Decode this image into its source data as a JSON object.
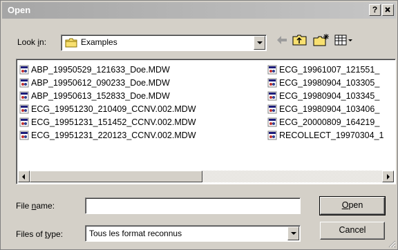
{
  "window": {
    "title": "Open",
    "help_label": "?",
    "close_label": "X"
  },
  "lookin": {
    "label_pre": "Look ",
    "label_u": "i",
    "label_post": "n:",
    "value": "Examples"
  },
  "files": {
    "col1": [
      "ABP_19950529_121633_Doe.MDW",
      "ABP_19950612_090233_Doe.MDW",
      "ABP_19950613_152833_Doe.MDW",
      "ECG_19951230_210409_CCNV.002.MDW",
      "ECG_19951231_151452_CCNV.002.MDW",
      "ECG_19951231_220123_CCNV.002.MDW"
    ],
    "col2": [
      "ECG_19961007_121551_",
      "ECG_19980904_103305_",
      "ECG_19980904_103345_",
      "ECG_19980904_103406_",
      "ECG_20000809_164219_",
      "RECOLLECT_19970304_1"
    ]
  },
  "filename": {
    "label_pre": "File ",
    "label_u": "n",
    "label_post": "ame:",
    "value": ""
  },
  "filetype": {
    "label_pre": "Files of ",
    "label_u": "t",
    "label_post": "ype:",
    "value": "Tous les format reconnus"
  },
  "buttons": {
    "open_u": "O",
    "open_rest": "pen",
    "cancel": "Cancel"
  }
}
